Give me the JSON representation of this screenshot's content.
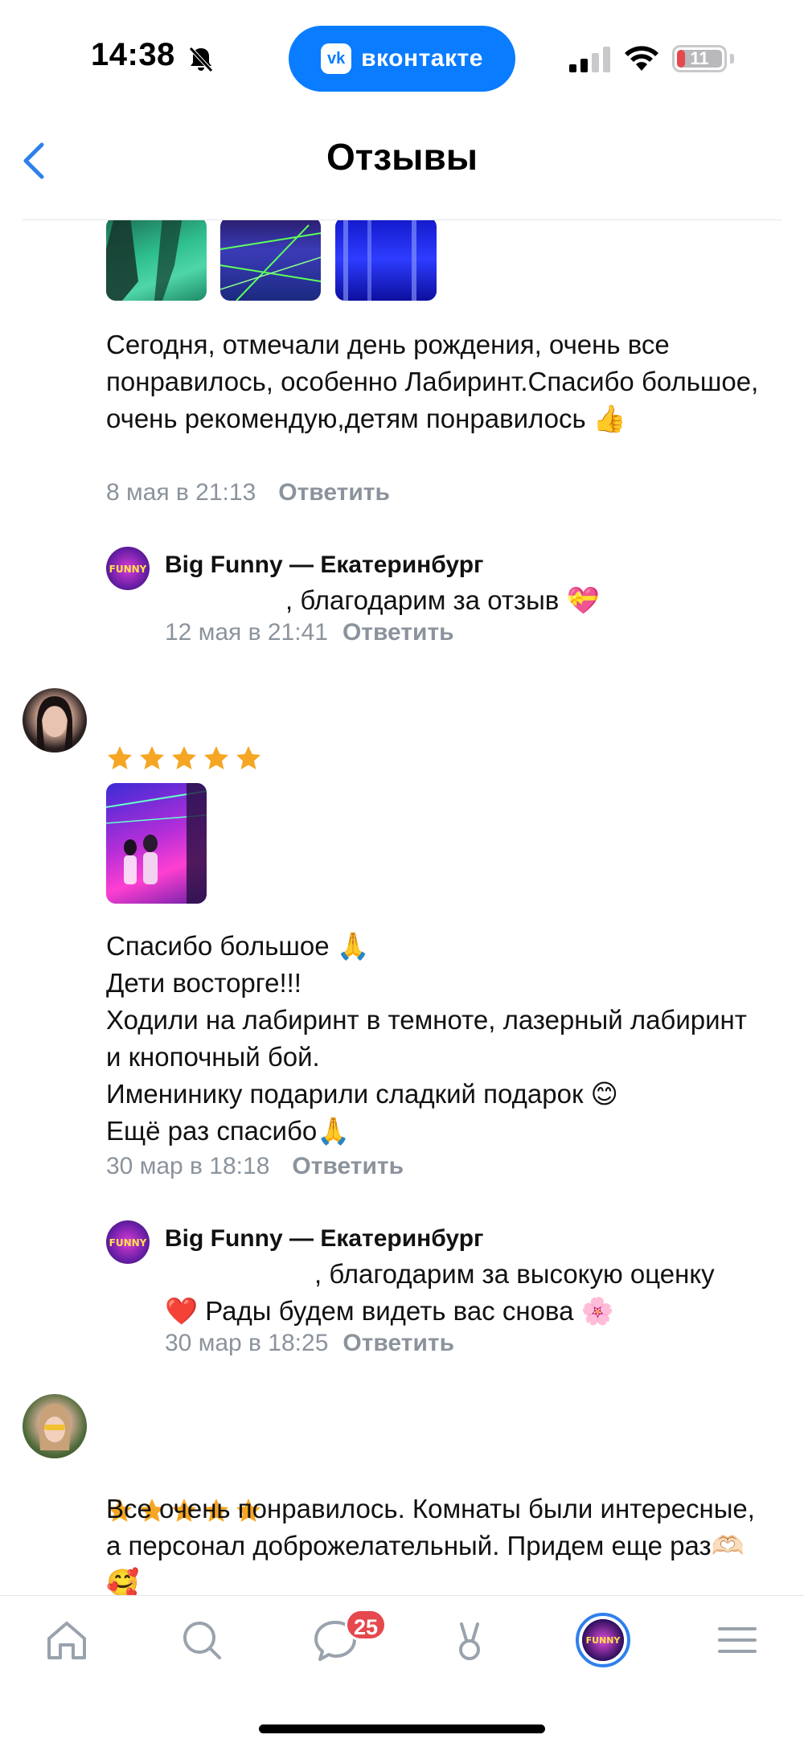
{
  "status_bar": {
    "time": "14:38",
    "app_pill": "вконтакте",
    "app_pill_logo": "vk",
    "battery": "11"
  },
  "header": {
    "title": "Отзывы"
  },
  "reviews": [
    {
      "text": "Сегодня, отмечали день рождения, очень все понравилось, особенно Лабиринт.Спасибо большое, очень рекомендую,детям понравилось 👍",
      "date": "8 мая в 21:13",
      "reply_label": "Ответить",
      "org_reply": {
        "author": "Big Funny — Екатеринбург",
        "text": ", благодарим за отзыв 💝",
        "date": "12 мая в 21:41",
        "reply_label": "Ответить"
      }
    },
    {
      "stars": 5,
      "text": "Спасибо большое 🙏\nДети восторге!!!\nХодили на лабиринт в темноте, лазерный лабиринт и кнопочный бой.\nИменинику подарили сладкий подарок 😊\nЕщё раз спасибо🙏",
      "date": "30 мар в 18:18",
      "reply_label": "Ответить",
      "org_reply": {
        "author": "Big Funny — Екатеринбург",
        "text": ", благодарим за высокую оценку\n❤️ Рады будем видеть вас снова 🌸",
        "date": "30 мар в 18:25",
        "reply_label": "Ответить"
      }
    },
    {
      "stars": 5,
      "text": "Все очень понравилось. Комнаты были интересные, а персонал доброжелательный. Придем еще раз🫶🏻🥰"
    }
  ],
  "tab_bar": {
    "items": [
      "home-icon",
      "search-icon",
      "messages-icon",
      "clips-icon",
      "profile-avatar",
      "menu-icon"
    ],
    "messages_badge": "25"
  },
  "colors": {
    "accent": "#0a7cff",
    "star": "#f5a623",
    "meta": "#8b939c",
    "badge": "#e5484d"
  }
}
